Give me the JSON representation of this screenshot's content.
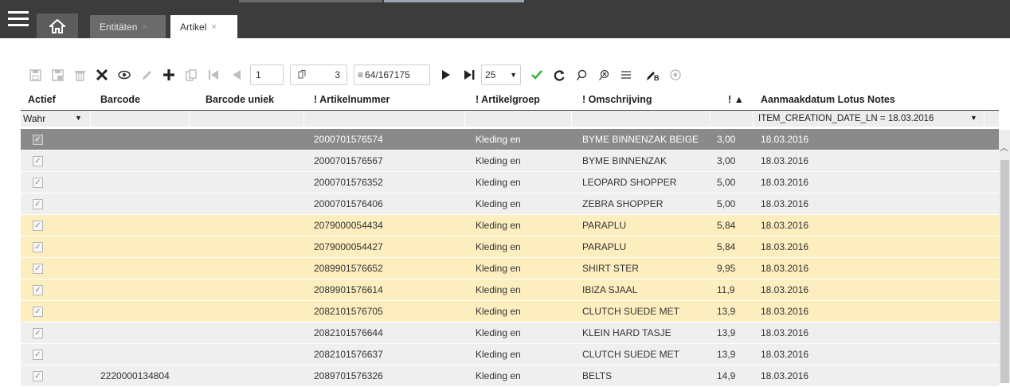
{
  "header": {
    "tabs": [
      {
        "label": "Entitäten",
        "active": false
      },
      {
        "label": "Artikel",
        "active": true
      }
    ],
    "close_glyph": "×"
  },
  "toolbar": {
    "icons": [
      "save-icon",
      "save-as-icon",
      "delete-icon",
      "cancel-icon",
      "view-icon",
      "edit-icon",
      "add-icon",
      "copy-icon",
      "first-icon",
      "prev-icon"
    ],
    "page_value": "1",
    "page_of_label": "3",
    "record_counter": "64/167175",
    "page_size": "25",
    "colors": {
      "accent_green": "#3cb043",
      "disabled": "#bdbdbd"
    }
  },
  "grid": {
    "columns": [
      "Actief",
      "Barcode",
      "Barcode uniek",
      "! Artikelnummer",
      "! Artikelgroep",
      "! Omschrijving",
      "! ▲",
      "Aanmaakdatum Lotus Notes"
    ],
    "filter": {
      "actief_value": "Wahr",
      "date_filter": "ITEM_CREATION_DATE_LN = 18.03.2016"
    },
    "rows": [
      {
        "style": "sel",
        "barcode": "",
        "artikelnummer": "2000701576574",
        "artikelgroep": "Kleding en",
        "omschrijving": "BYME BINNENZAK BEIGE",
        "prijs": "3,00",
        "datum": "18.03.2016"
      },
      {
        "style": "norm",
        "barcode": "",
        "artikelnummer": "2000701576567",
        "artikelgroep": "Kleding en",
        "omschrijving": "BYME BINNENZAK",
        "prijs": "3,00",
        "datum": "18.03.2016"
      },
      {
        "style": "norm",
        "barcode": "",
        "artikelnummer": "2000701576352",
        "artikelgroep": "Kleding en",
        "omschrijving": "LEOPARD SHOPPER",
        "prijs": "5,00",
        "datum": "18.03.2016"
      },
      {
        "style": "norm",
        "barcode": "",
        "artikelnummer": "2000701576406",
        "artikelgroep": "Kleding en",
        "omschrijving": "ZEBRA SHOPPER",
        "prijs": "5,00",
        "datum": "18.03.2016"
      },
      {
        "style": "yel",
        "barcode": "",
        "artikelnummer": "2079000054434",
        "artikelgroep": "Kleding en",
        "omschrijving": "PARAPLU",
        "prijs": "5,84",
        "datum": "18.03.2016"
      },
      {
        "style": "yel",
        "barcode": "",
        "artikelnummer": "2079000054427",
        "artikelgroep": "Kleding en",
        "omschrijving": "PARAPLU",
        "prijs": "5,84",
        "datum": "18.03.2016"
      },
      {
        "style": "yel",
        "barcode": "",
        "artikelnummer": "2089901576652",
        "artikelgroep": "Kleding en",
        "omschrijving": "SHIRT STER",
        "prijs": "9,95",
        "datum": "18.03.2016"
      },
      {
        "style": "yel",
        "barcode": "",
        "artikelnummer": "2089901576614",
        "artikelgroep": "Kleding en",
        "omschrijving": "IBIZA SJAAL",
        "prijs": "11,9",
        "datum": "18.03.2016"
      },
      {
        "style": "yel",
        "barcode": "",
        "artikelnummer": "2082101576705",
        "artikelgroep": "Kleding en",
        "omschrijving": "CLUTCH SUEDE MET",
        "prijs": "13,9",
        "datum": "18.03.2016"
      },
      {
        "style": "norm",
        "barcode": "",
        "artikelnummer": "2082101576644",
        "artikelgroep": "Kleding en",
        "omschrijving": "KLEIN HARD TASJE",
        "prijs": "13,9",
        "datum": "18.03.2016"
      },
      {
        "style": "norm",
        "barcode": "",
        "artikelnummer": "2082101576637",
        "artikelgroep": "Kleding en",
        "omschrijving": "CLUTCH SUEDE MET",
        "prijs": "13,9",
        "datum": "18.03.2016"
      },
      {
        "style": "norm",
        "barcode": "2220000134804",
        "artikelnummer": "2089701576326",
        "artikelgroep": "Kleding en",
        "omschrijving": "BELTS",
        "prijs": "14,9",
        "datum": "18.03.2016"
      }
    ],
    "row_colors": {
      "selected": "#8a8a8a",
      "normal": "#efefef",
      "highlight": "#fdeebf"
    }
  }
}
